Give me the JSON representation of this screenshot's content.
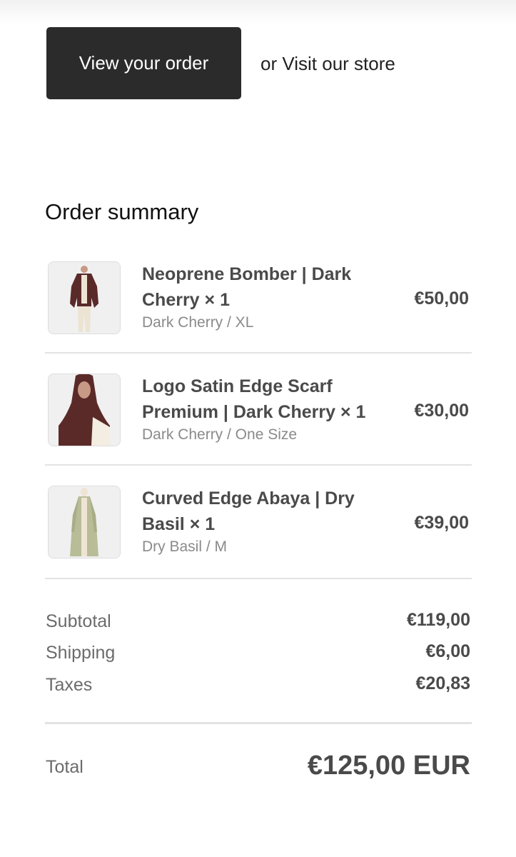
{
  "actions": {
    "view_order_label": "View your order",
    "or_text": "or",
    "visit_store_label": "Visit our store"
  },
  "summary": {
    "title": "Order summary",
    "items": [
      {
        "name": "Neoprene Bomber | Dark Cherry × 1",
        "variant": "Dark Cherry / XL",
        "price": "€50,00",
        "thumbnail_icon": "jacket-product-image",
        "color": "#5a2a29"
      },
      {
        "name": "Logo Satin Edge Scarf Premium | Dark Cherry × 1",
        "variant": "Dark Cherry / One Size",
        "price": "€30,00",
        "thumbnail_icon": "scarf-product-image",
        "color": "#5a2a29"
      },
      {
        "name": "Curved Edge Abaya | Dry Basil × 1",
        "variant": "Dry Basil / M",
        "price": "€39,00",
        "thumbnail_icon": "abaya-product-image",
        "color": "#b8bd98"
      }
    ],
    "subtotal_label": "Subtotal",
    "subtotal_value": "€119,00",
    "shipping_label": "Shipping",
    "shipping_value": "€6,00",
    "taxes_label": "Taxes",
    "taxes_value": "€20,83",
    "total_label": "Total",
    "total_value": "€125,00 EUR"
  },
  "colors": {
    "button_bg": "#2b2b2b",
    "text_primary": "#4a4a4a",
    "text_muted": "#8a8a8a",
    "divider": "#e3e3e3"
  }
}
